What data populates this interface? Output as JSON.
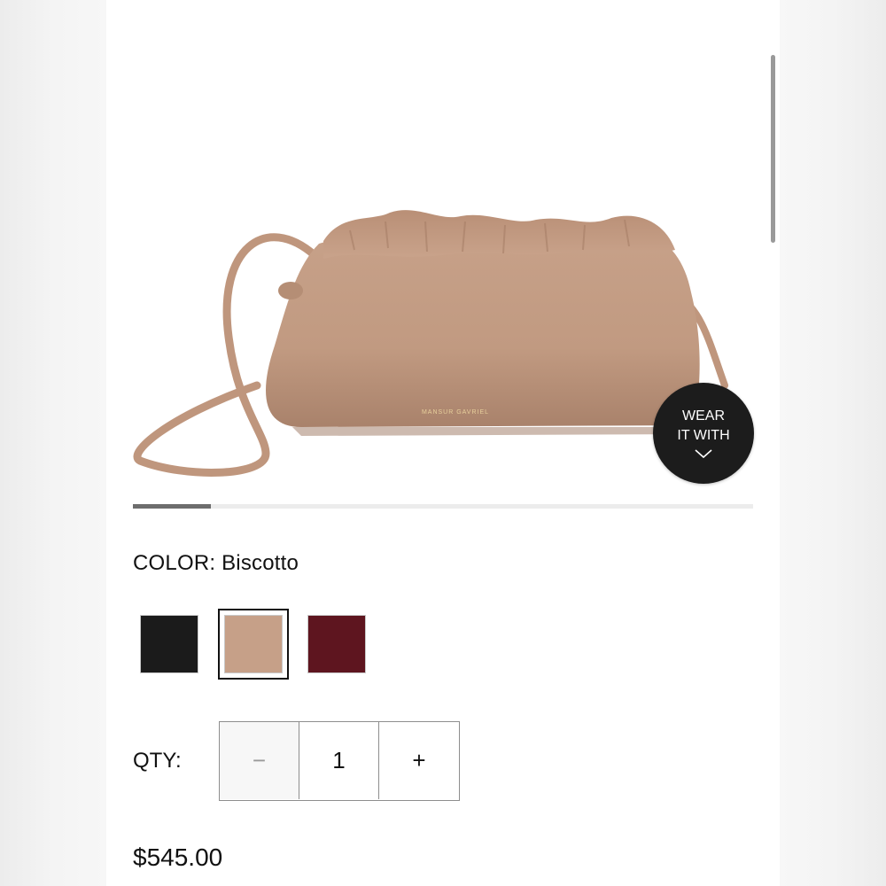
{
  "product": {
    "brand_stamp": "MANSUR GAVRIEL",
    "image_alt": "Biscotto leather cloud clutch with crossbody strap"
  },
  "wear_button": {
    "line1": "WEAR",
    "line2": "IT WITH",
    "icon": "chevron-down-icon"
  },
  "carousel": {
    "progress": 0.125
  },
  "color": {
    "label": "COLOR:",
    "selected": "Biscotto",
    "swatches": [
      {
        "name": "Black",
        "hex": "#1b1b1b",
        "selected": false
      },
      {
        "name": "Biscotto",
        "hex": "#c6a088",
        "selected": true
      },
      {
        "name": "Burgundy",
        "hex": "#5e151f",
        "selected": false
      }
    ]
  },
  "quantity": {
    "label": "QTY:",
    "value": "1",
    "minus": "−",
    "plus": "+"
  },
  "price": "$545.00",
  "colors": {
    "bag": "#c49c84",
    "bag_shadow": "#a98068",
    "strap": "#bf967d",
    "button_bg": "#1c1c1c"
  }
}
